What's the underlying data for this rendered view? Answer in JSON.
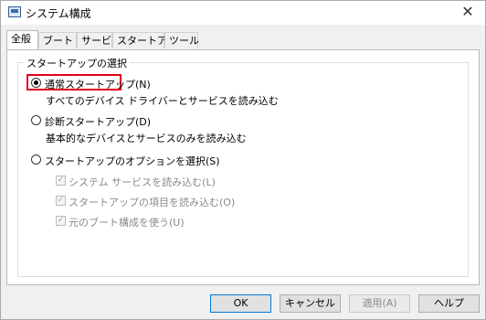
{
  "window": {
    "title": "システム構成",
    "close_glyph": "✕",
    "icon": "system-config-icon"
  },
  "tabs": [
    {
      "label": "全般",
      "active": true
    },
    {
      "label": "ブート",
      "active": false
    },
    {
      "label": "サービス",
      "active": false
    },
    {
      "label": "スタートアップ",
      "active": false
    },
    {
      "label": "ツール",
      "active": false
    }
  ],
  "startup_group": {
    "title": "スタートアップの選択",
    "normal": {
      "label": "通常スタートアップ(N)",
      "description": "すべてのデバイス ドライバーとサービスを読み込む",
      "selected": true
    },
    "diagnostic": {
      "label": "診断スタートアップ(D)",
      "description": "基本的なデバイスとサービスのみを読み込む",
      "selected": false
    },
    "selective": {
      "label": "スタートアップのオプションを選択(S)",
      "selected": false,
      "options": [
        {
          "label": "システム サービスを読み込む(L)",
          "checked": true,
          "enabled": false
        },
        {
          "label": "スタートアップの項目を読み込む(O)",
          "checked": true,
          "enabled": false
        },
        {
          "label": "元のブート構成を使う(U)",
          "checked": true,
          "enabled": false
        }
      ]
    }
  },
  "buttons": {
    "ok": "OK",
    "cancel": "キャンセル",
    "apply": "適用(A)",
    "help": "ヘルプ"
  },
  "colors": {
    "highlight": "#e2001a",
    "accent": "#0078d7"
  }
}
